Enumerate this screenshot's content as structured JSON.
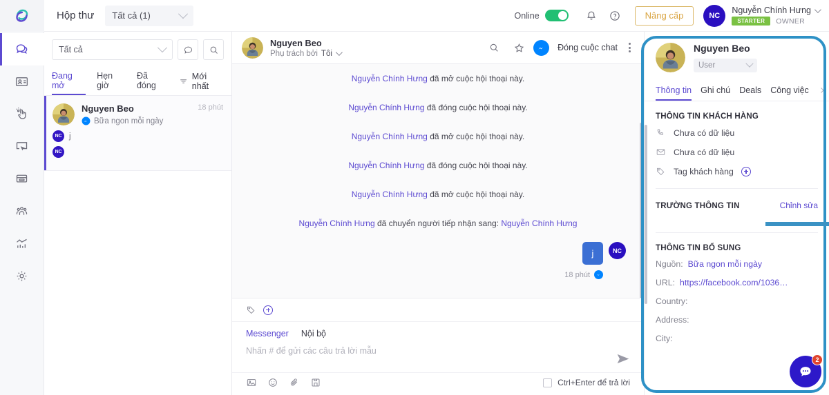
{
  "topbar": {
    "title": "Hộp thư",
    "mailbox_filter": "Tất cả (1)",
    "online_label": "Online",
    "bell_icon": "bell-icon",
    "help_icon": "help-circle-icon",
    "upgrade_label": "Nâng cấp",
    "user_initials": "NC",
    "user_name": "Nguyễn Chính Hưng",
    "plan_badge": "STARTER",
    "role_label": "OWNER",
    "accent_purple": "#5c4ad1",
    "toggle_green": "#21bf73",
    "upgrade_gold": "#d9a441"
  },
  "rail": {
    "logo_icon": "app-logo-icon",
    "items": [
      {
        "icon": "chat-bubble-icon",
        "name": "inbox",
        "active": true
      },
      {
        "icon": "contact-card-icon",
        "name": "contacts",
        "active": false
      },
      {
        "icon": "hand-click-icon",
        "name": "automation",
        "active": false
      },
      {
        "icon": "cursor-screen-icon",
        "name": "campaigns",
        "active": false
      },
      {
        "icon": "window-icon",
        "name": "pages",
        "active": false
      },
      {
        "icon": "users-group-icon",
        "name": "team",
        "active": false
      },
      {
        "icon": "analytics-chart-icon",
        "name": "reports",
        "active": false
      },
      {
        "icon": "gear-icon",
        "name": "settings",
        "active": false
      }
    ]
  },
  "conversation_list": {
    "filter_value": "Tất cả",
    "chat_filter_icon": "chat-filter-icon",
    "search_icon": "search-icon",
    "tabs": [
      {
        "label": "Đang mở",
        "active": true
      },
      {
        "label": "Hẹn giờ",
        "active": false
      },
      {
        "label": "Đã đóng",
        "active": false
      }
    ],
    "sort_icon": "sort-icon",
    "sort_label": "Mới nhất",
    "items": [
      {
        "name": "Nguyen Beo",
        "channel_icon": "messenger-icon",
        "page_name": "Bữa ngon mỗi ngày",
        "time": "18 phút",
        "replies": [
          {
            "initials": "NC",
            "text": "j"
          },
          {
            "initials": "NC",
            "text": ""
          }
        ]
      }
    ]
  },
  "chat": {
    "header": {
      "name": "Nguyen Beo",
      "assigned_label": "Phụ trách bởi",
      "assigned_value": "Tôi",
      "search_icon": "search-icon",
      "star_icon": "star-icon",
      "messenger_icon": "messenger-icon",
      "close_chat_label": "Đóng cuộc chat",
      "more_icon": "more-vertical-icon"
    },
    "system_messages": [
      {
        "actor": "Nguyễn Chính Hưng",
        "text": " đã mở cuộc hội thoại này."
      },
      {
        "actor": "Nguyễn Chính Hưng",
        "text": " đã đóng cuộc hội thoại này."
      },
      {
        "actor": "Nguyễn Chính Hưng",
        "text": " đã mở cuộc hội thoại này."
      },
      {
        "actor": "Nguyễn Chính Hưng",
        "text": " đã đóng cuộc hội thoại này."
      },
      {
        "actor": "Nguyễn Chính Hưng",
        "text": " đã mở cuộc hội thoại này."
      }
    ],
    "transfer_message": {
      "actor": "Nguyễn Chính Hưng",
      "text": " đã chuyển người tiếp nhận sang: ",
      "target": "Nguyễn Chính Hưng"
    },
    "outgoing_bubble": {
      "text": "j",
      "avatar_initials": "NC",
      "time": "18 phút",
      "channel_icon": "messenger-icon"
    }
  },
  "composer": {
    "tag_icon": "tag-icon",
    "add_tag_icon": "plus-circle-icon",
    "channels": [
      {
        "label": "Messenger",
        "active": true
      },
      {
        "label": "Nội bộ",
        "active": false
      }
    ],
    "placeholder": "Nhấn # để gửi các câu trả lời mẫu",
    "send_icon": "send-icon",
    "tools": [
      {
        "icon": "image-icon",
        "name": "insert-image"
      },
      {
        "icon": "emoji-icon",
        "name": "insert-emoji"
      },
      {
        "icon": "paperclip-icon",
        "name": "attach-file"
      },
      {
        "icon": "saved-reply-icon",
        "name": "saved-replies"
      }
    ],
    "shortcut_label": "Ctrl+Enter để trả lời"
  },
  "info_panel": {
    "name": "Nguyen Beo",
    "role_value": "User",
    "tabs": [
      {
        "label": "Thông tin",
        "active": true
      },
      {
        "label": "Ghi chú",
        "active": false
      },
      {
        "label": "Deals",
        "active": false
      },
      {
        "label": "Công việc",
        "active": false
      }
    ],
    "next_tab_icon": "chevron-right-icon",
    "customer_section_title": "THÔNG TIN KHÁCH HÀNG",
    "customer_rows": [
      {
        "icon": "phone-icon",
        "value": "Chưa có dữ liệu"
      },
      {
        "icon": "mail-icon",
        "value": "Chưa có dữ liệu"
      }
    ],
    "tag_row": {
      "icon": "tag-icon",
      "label": "Tag khách hàng",
      "add_icon": "plus-circle-icon"
    },
    "fields_section_title": "TRƯỜNG THÔNG TIN",
    "fields_edit_label": "Chỉnh sửa",
    "extra_section_title": "THÔNG TIN BỔ SUNG",
    "extra_fields": [
      {
        "label": "Nguồn:",
        "value": "Bữa ngon mỗi ngày",
        "link": true
      },
      {
        "label": "URL:",
        "value": "https://facebook.com/1036…",
        "link": true
      },
      {
        "label": "Country:",
        "value": "",
        "link": false
      },
      {
        "label": "Address:",
        "value": "",
        "link": false
      },
      {
        "label": "City:",
        "value": "",
        "link": false
      }
    ]
  },
  "annotations": {
    "highlight_color": "#2e91c6",
    "arrow_color": "#3a92c4",
    "arrow_name": "pointer-arrow-annotation",
    "box_name": "info-panel-highlight-annotation"
  },
  "chat_widget": {
    "icon": "chat-bubble-dots-icon",
    "badge_count": "2",
    "color": "#2d19c9",
    "badge_color": "#e0442d"
  }
}
